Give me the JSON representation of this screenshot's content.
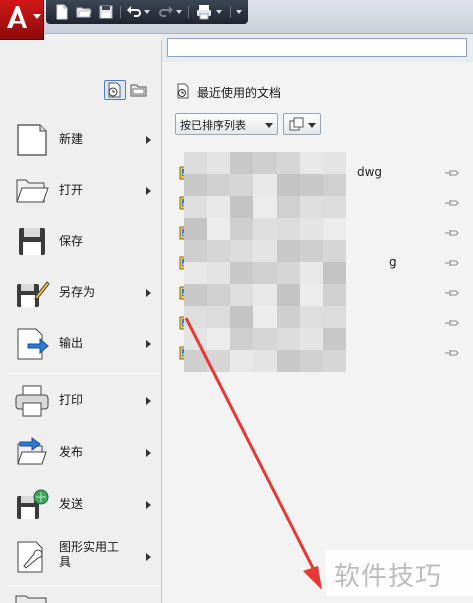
{
  "app": {
    "name": "AutoCAD"
  },
  "search": {
    "value": "",
    "placeholder": ""
  },
  "left_menu": {
    "items": [
      {
        "label": "新建",
        "icon": "new-document-icon",
        "submenu": true
      },
      {
        "label": "打开",
        "icon": "open-folder-icon",
        "submenu": true
      },
      {
        "label": "保存",
        "icon": "save-disk-icon",
        "submenu": false
      },
      {
        "label": "另存为",
        "icon": "save-as-icon",
        "submenu": true
      },
      {
        "label": "输出",
        "icon": "export-icon",
        "submenu": true
      },
      {
        "label": "打印",
        "icon": "print-icon",
        "submenu": true
      },
      {
        "label": "发布",
        "icon": "publish-icon",
        "submenu": true
      },
      {
        "label": "发送",
        "icon": "send-icon",
        "submenu": true
      },
      {
        "label": "图形实用工具",
        "label_line1": "图形实用工",
        "label_line2": "具",
        "icon": "drawing-utilities-icon",
        "submenu": true
      }
    ]
  },
  "recent": {
    "title": "最近使用的文档",
    "sort_label": "按已排序列表",
    "documents": [
      {
        "ext_visible": "dwg",
        "icon": "dwg-file-icon"
      },
      {
        "ext_visible": "",
        "icon": "dwg-file-icon"
      },
      {
        "ext_visible": "",
        "icon": "dwg-file-icon"
      },
      {
        "ext_visible": "g",
        "icon": "dwg-file-icon"
      },
      {
        "ext_visible": "",
        "icon": "dwg-file-icon"
      },
      {
        "ext_visible": "",
        "icon": "dwg-file-icon"
      },
      {
        "ext_visible": "",
        "icon": "dwg-file-icon"
      }
    ]
  },
  "watermark": {
    "text": "软件技巧"
  },
  "colors": {
    "app_red": "#c01414",
    "qat_bg": "#2a323d",
    "selection_blue": "#4a7fc9",
    "annotation_arrow": "#e53935"
  }
}
